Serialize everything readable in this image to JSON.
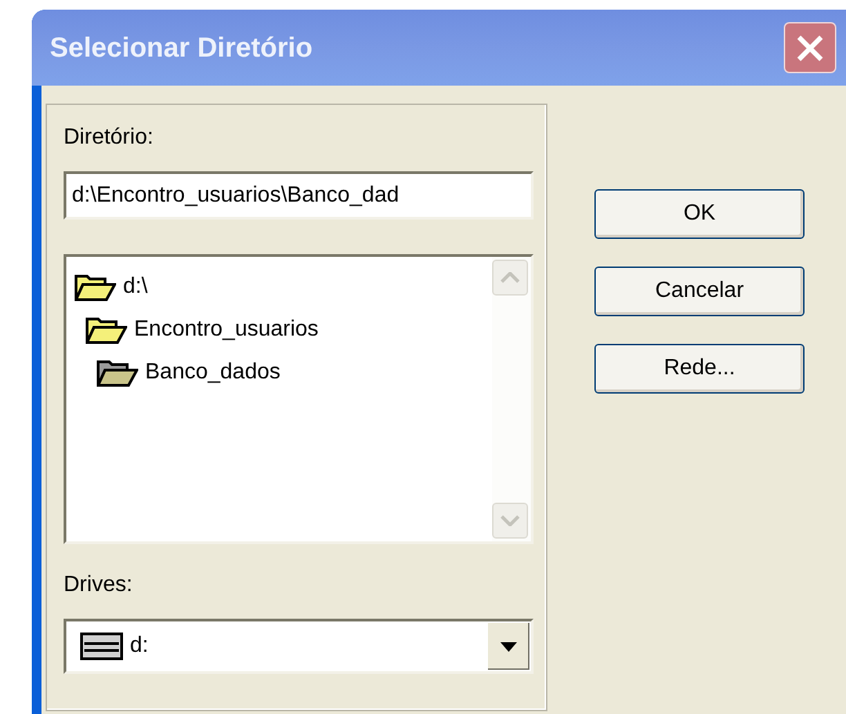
{
  "window": {
    "title": "Selecionar Diretório"
  },
  "directory": {
    "label": "Diretório:",
    "value": "d:\\Encontro_usuarios\\Banco_dad"
  },
  "folders": [
    {
      "name": "d:\\",
      "selected": false,
      "children": [
        {
          "name": "Encontro_usuarios",
          "selected": false,
          "children": [
            {
              "name": "Banco_dados",
              "selected": true
            }
          ]
        }
      ]
    }
  ],
  "drives": {
    "label": "Drives:",
    "value": "d:"
  },
  "buttons": [
    "OK",
    "Cancelar",
    "Rede..."
  ]
}
